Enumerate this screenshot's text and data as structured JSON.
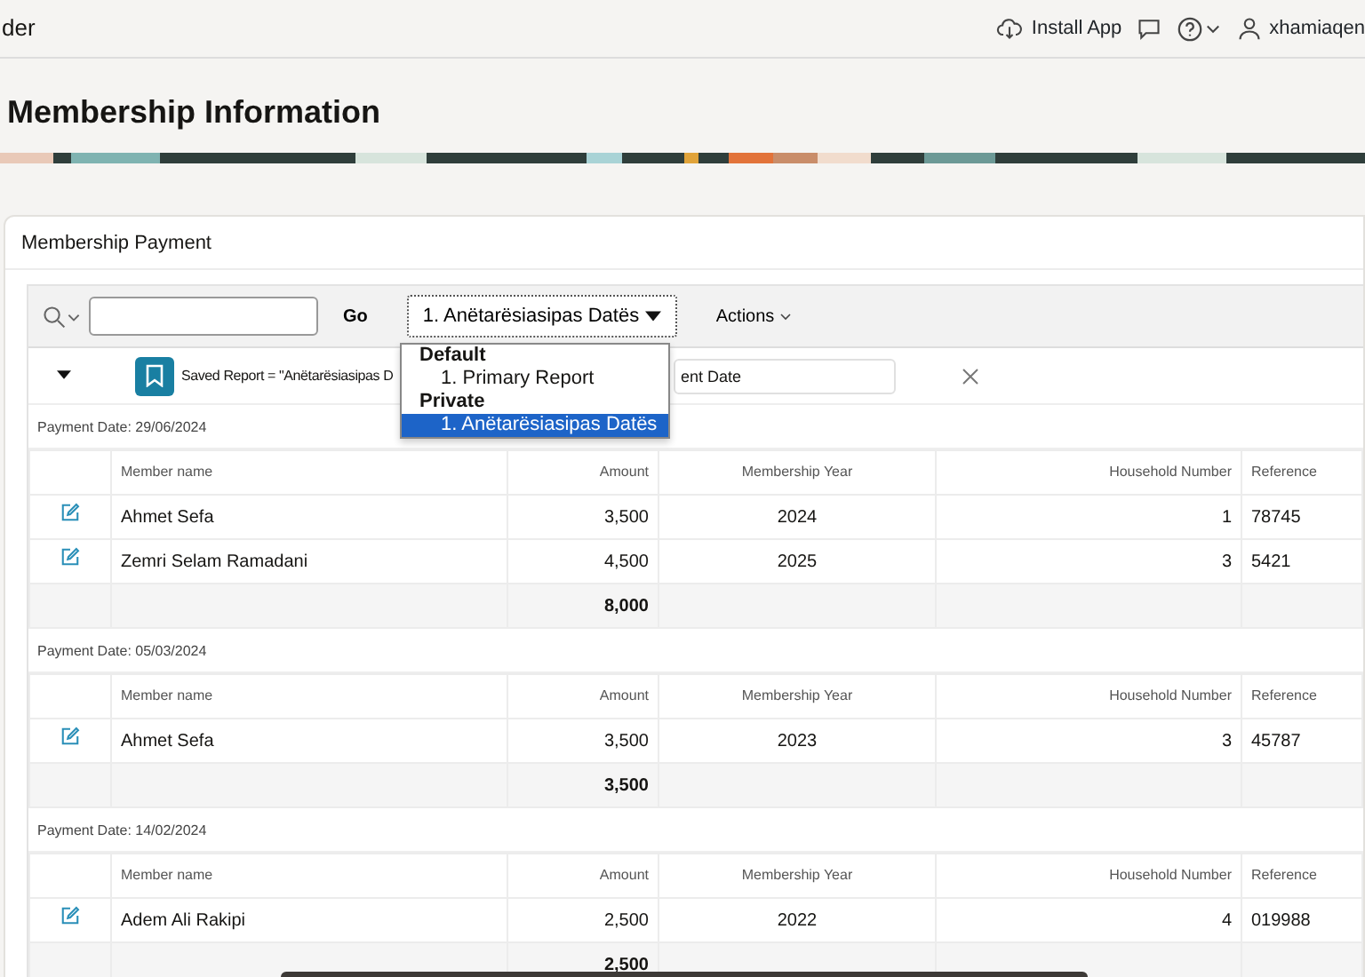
{
  "header": {
    "app_name": "der",
    "install": "Install App",
    "user": "xhamiaqen"
  },
  "page_title": "Membership Information",
  "region": {
    "title": "Membership Payment",
    "toolbar": {
      "go": "Go",
      "report_select": "1. Anëtarësiasipas Datës",
      "actions": "Actions"
    },
    "report_menu": [
      {
        "kind": "group",
        "label": "Default"
      },
      {
        "kind": "option",
        "label": "1. Primary Report",
        "selected": false
      },
      {
        "kind": "group",
        "label": "Private"
      },
      {
        "kind": "option",
        "label": "1. Anëtarësiasipas Datës",
        "selected": true
      }
    ],
    "filter": {
      "saved_report": "Saved Report = \"Anëtarësiasipas D",
      "break_field": "ent Date"
    },
    "groups": [
      {
        "label": "Payment Date: 29/06/2024",
        "columns": [
          "Member name",
          "Amount",
          "Membership Year",
          "Household Number",
          "Reference"
        ],
        "rows": [
          [
            "Ahmet Sefa",
            "3,500",
            "2024",
            "1",
            "78745"
          ],
          [
            "Zemri Selam Ramadani",
            "4,500",
            "2025",
            "3",
            "5421"
          ]
        ],
        "total": "8,000"
      },
      {
        "label": "Payment Date: 05/03/2024",
        "columns": [
          "Member name",
          "Amount",
          "Membership Year",
          "Household Number",
          "Reference"
        ],
        "rows": [
          [
            "Ahmet Sefa",
            "3,500",
            "2023",
            "3",
            "45787"
          ]
        ],
        "total": "3,500"
      },
      {
        "label": "Payment Date: 14/02/2024",
        "columns": [
          "Member name",
          "Amount",
          "Membership Year",
          "Household Number",
          "Reference"
        ],
        "rows": [
          [
            "Adem Ali Rakipi",
            "2,500",
            "2022",
            "4",
            "019988"
          ]
        ],
        "total": "2,500"
      }
    ]
  }
}
